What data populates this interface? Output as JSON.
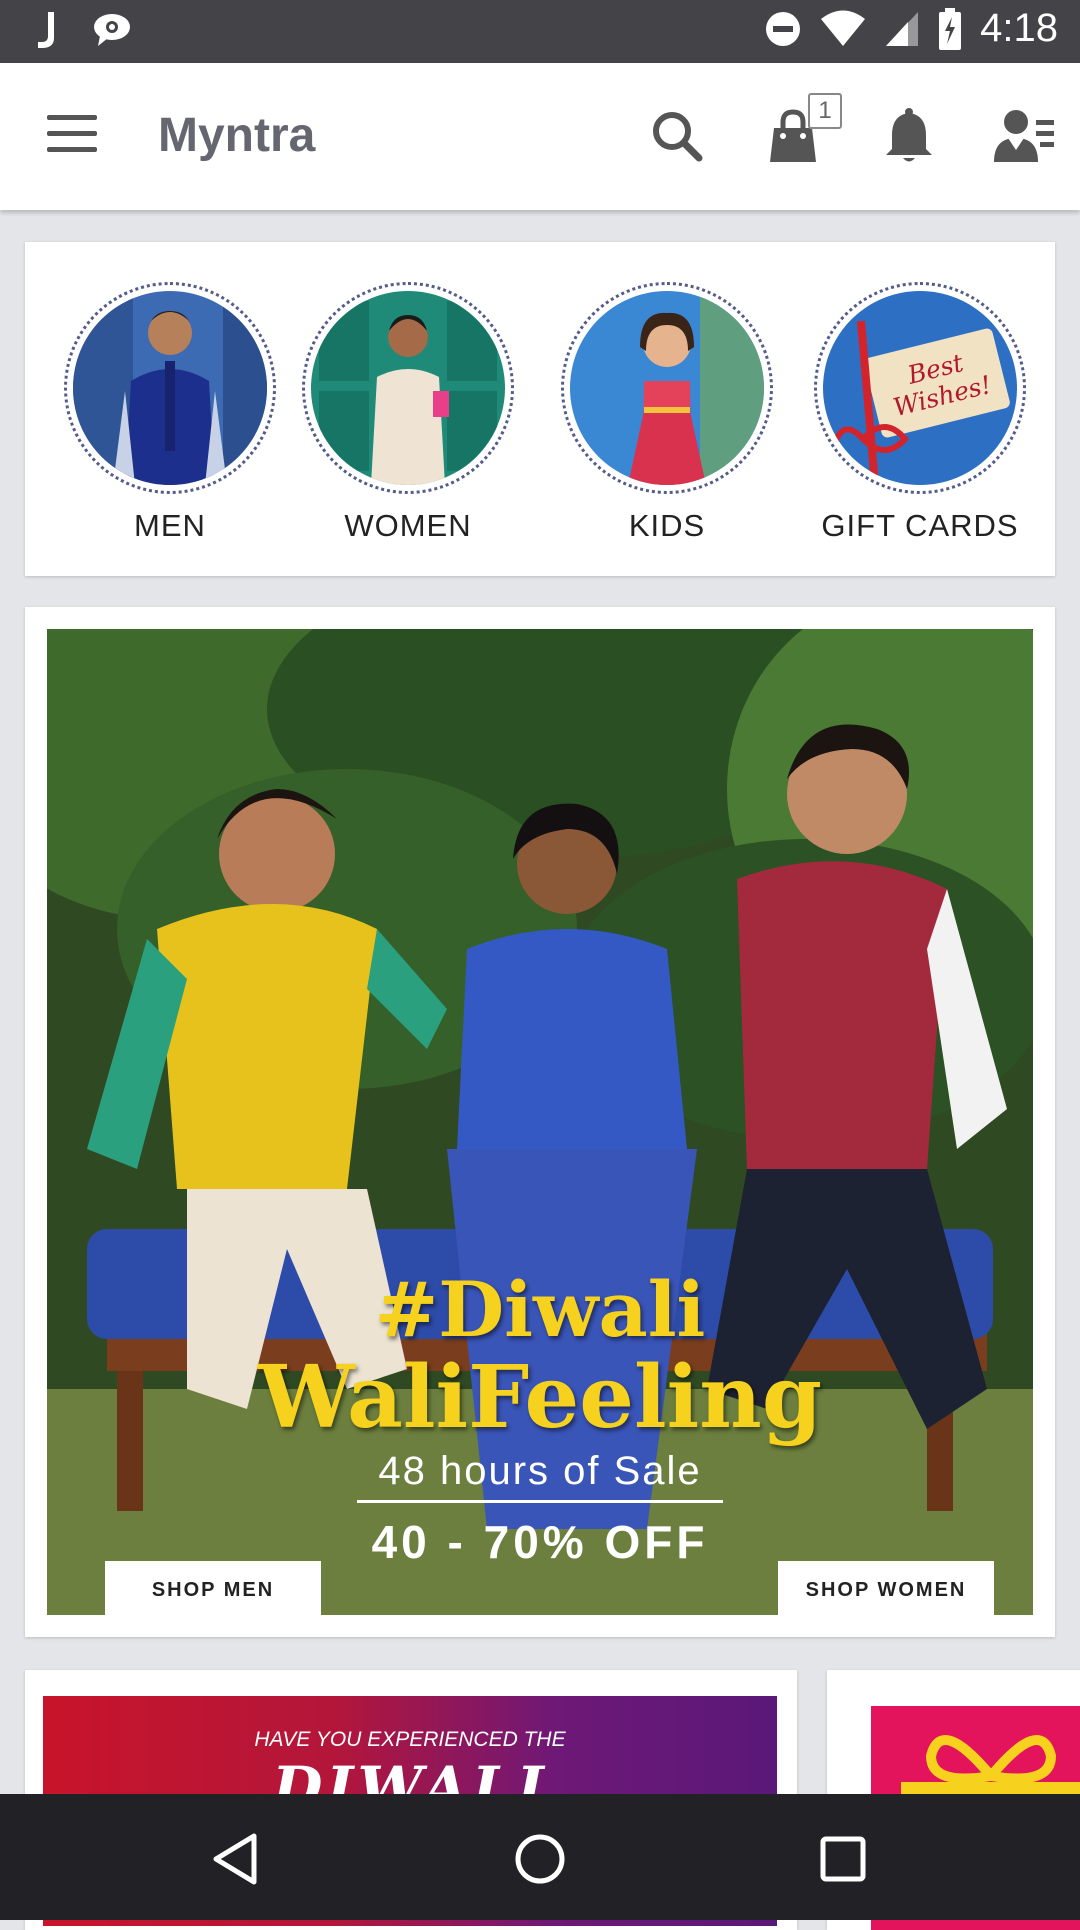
{
  "status_bar": {
    "time": "4:18",
    "left_icons": [
      "jio-j-icon",
      "chat-bubble-icon"
    ],
    "right_icons": [
      "do-not-disturb-icon",
      "wifi-icon",
      "cell-signal-icon",
      "battery-charging-icon"
    ]
  },
  "app_bar": {
    "title": "Myntra",
    "bag_count": "1",
    "actions": [
      "search-icon",
      "shopping-bag-icon",
      "notifications-bell-icon",
      "profile-icon"
    ]
  },
  "categories": [
    {
      "label": "MEN"
    },
    {
      "label": "WOMEN"
    },
    {
      "label": "KIDS"
    },
    {
      "label": "GIFT CARDS",
      "card_text": "Best Wishes!"
    }
  ],
  "hero_banner": {
    "line1": "#Diwali",
    "line2": "WaliFeeling",
    "line3": "48 hours of Sale",
    "line4": "40 - 70% OFF",
    "shop_men": "SHOP MEN",
    "shop_women": "SHOP WOMEN"
  },
  "promo_banner": {
    "line1": "HAVE YOU EXPERIENCED THE",
    "line2": "DIWALI"
  },
  "nav_bar": {
    "buttons": [
      "back-icon",
      "home-icon",
      "recents-icon"
    ]
  },
  "colors": {
    "status_bar": "#444448",
    "app_bar": "#ffffff",
    "title_text": "#656670",
    "banner_yellow": "#f6d21e",
    "nav_bar": "#222226",
    "background": "#e4e5e8"
  }
}
